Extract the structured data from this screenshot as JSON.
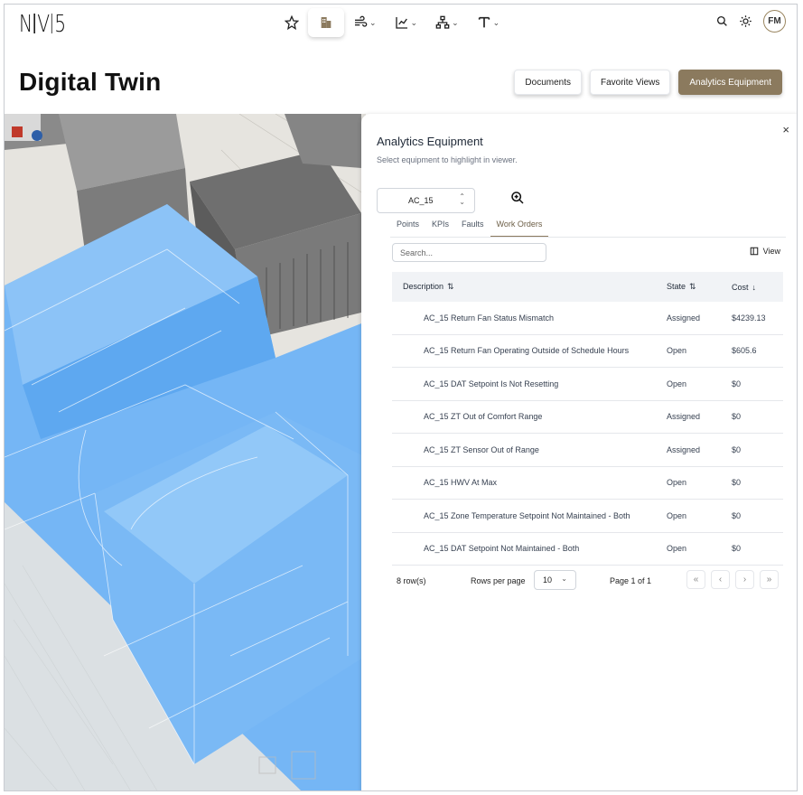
{
  "nav": {
    "logo_left": "N",
    "logo_mid": "V",
    "logo_right": "5",
    "avatar_initials": "FM"
  },
  "header": {
    "title": "Digital Twin",
    "buttons": {
      "documents": "Documents",
      "favorite_views": "Favorite Views",
      "analytics_equipment": "Analytics Equipment"
    }
  },
  "panel": {
    "title": "Analytics Equipment",
    "subtitle": "Select equipment to highlight in viewer.",
    "close": "×",
    "equipment_selected": "AC_15",
    "tabs": [
      "Points",
      "KPIs",
      "Faults",
      "Work Orders"
    ],
    "active_tab": "Work Orders",
    "search_placeholder": "Search...",
    "view_label": "View",
    "columns": {
      "description": "Description",
      "state": "State",
      "cost": "Cost"
    },
    "rows": [
      {
        "description": "AC_15 Return Fan Status Mismatch",
        "state": "Assigned",
        "cost": "$4239.13"
      },
      {
        "description": "AC_15 Return Fan Operating Outside of Schedule Hours",
        "state": "Open",
        "cost": "$605.6"
      },
      {
        "description": "AC_15 DAT Setpoint Is Not Resetting",
        "state": "Open",
        "cost": "$0"
      },
      {
        "description": "AC_15 ZT Out of Comfort Range",
        "state": "Assigned",
        "cost": "$0"
      },
      {
        "description": "AC_15 ZT Sensor Out of Range",
        "state": "Assigned",
        "cost": "$0"
      },
      {
        "description": "AC_15 HWV At Max",
        "state": "Open",
        "cost": "$0"
      },
      {
        "description": "AC_15 Zone Temperature Setpoint Not Maintained - Both",
        "state": "Open",
        "cost": "$0"
      },
      {
        "description": "AC_15 DAT Setpoint Not Maintained - Both",
        "state": "Open",
        "cost": "$0"
      }
    ],
    "footer": {
      "row_count": "8 row(s)",
      "rows_per_page_label": "Rows per page",
      "rows_per_page_value": "10",
      "page_of": "Page 1 of 1"
    }
  },
  "colors": {
    "accent": "#8b7a5e",
    "highlight_blue": "#6fb3f5"
  }
}
